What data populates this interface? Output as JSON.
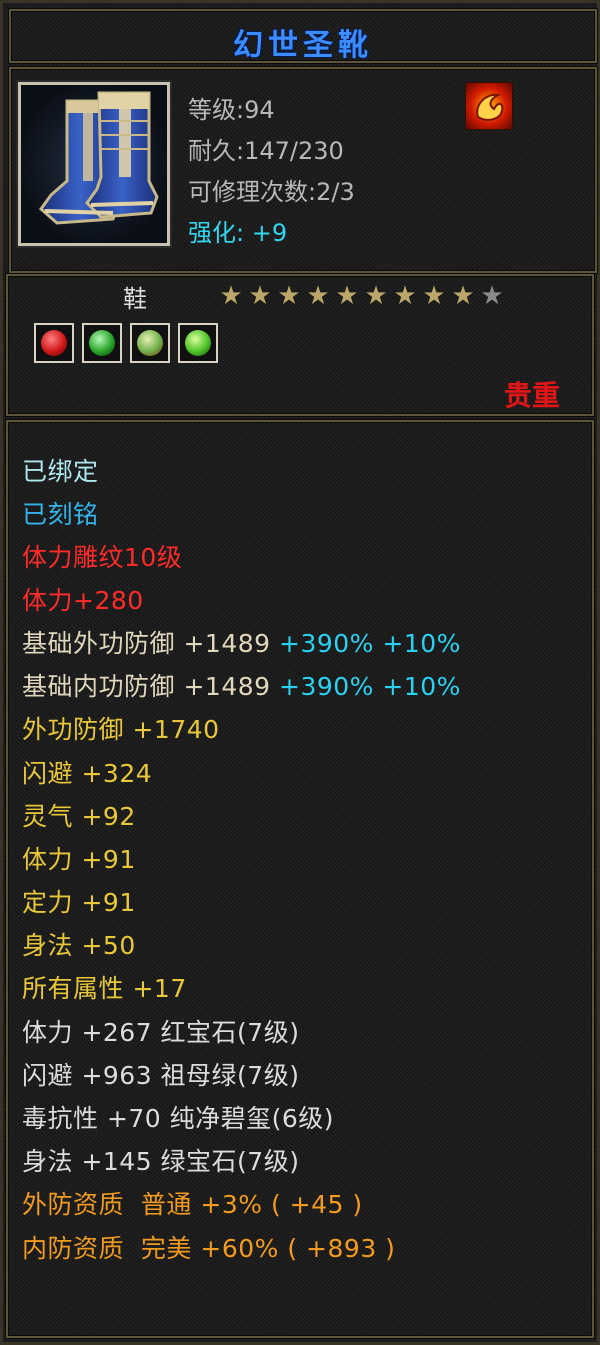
{
  "item": {
    "name": "幻世圣靴",
    "icon": "boots-icon",
    "level_label": "等级",
    "level": "94",
    "durability_label": "耐久",
    "durability": "147/230",
    "repair_label": "可修理次数",
    "repair": "2/3",
    "enhance_label": "强化:",
    "enhance": "+9",
    "emblem_icon": "flame-emblem-icon"
  },
  "type": {
    "label": "鞋",
    "stars_filled": 9,
    "stars_total": 10,
    "gems": [
      {
        "icon": "red-gem-icon",
        "color": "#d01818"
      },
      {
        "icon": "green-gem-icon",
        "color": "#28a428"
      },
      {
        "icon": "jade-gem-icon",
        "color": "#6fb04a"
      },
      {
        "icon": "emerald-gem-icon",
        "color": "#4ec228"
      }
    ],
    "rarity": "贵重"
  },
  "attributes": {
    "bound": "已绑定",
    "engraved": "已刻铭",
    "carving": "体力雕纹10级",
    "carving_bonus": "体力+280",
    "base_ext_def": {
      "label": "基础外功防御",
      "value": "+1489",
      "pct1": "+390%",
      "pct2": "+10%"
    },
    "base_int_def": {
      "label": "基础内功防御",
      "value": "+1489",
      "pct1": "+390%",
      "pct2": "+10%"
    },
    "ext_def": {
      "label": "外功防御",
      "value": "+1740"
    },
    "dodge": {
      "label": "闪避",
      "value": "+324"
    },
    "spirit": {
      "label": "灵气",
      "value": "+92"
    },
    "stamina": {
      "label": "体力",
      "value": "+91"
    },
    "focus": {
      "label": "定力",
      "value": "+91"
    },
    "agility": {
      "label": "身法",
      "value": "+50"
    },
    "all_attr": {
      "label": "所有属性",
      "value": "+17"
    },
    "gem_lines": [
      "体力 +267 红宝石(7级)",
      "闪避 +963 祖母绿(7级)",
      "毒抗性 +70 纯净碧玺(6级)",
      "身法 +145 绿宝石(7级)"
    ],
    "ext_quality": {
      "label": "外防资质",
      "grade": "普通",
      "pct": "+3%",
      "bonus": "( +45 )"
    },
    "int_quality": {
      "label": "内防资质",
      "grade": "完美",
      "pct": "+60%",
      "bonus": "( +893 )"
    }
  },
  "colors": {
    "title": "#3d8cff",
    "rarity": "#e01616",
    "yellow": "#e8c838",
    "orange": "#f29b1e",
    "cyan": "#2ad2f2"
  }
}
